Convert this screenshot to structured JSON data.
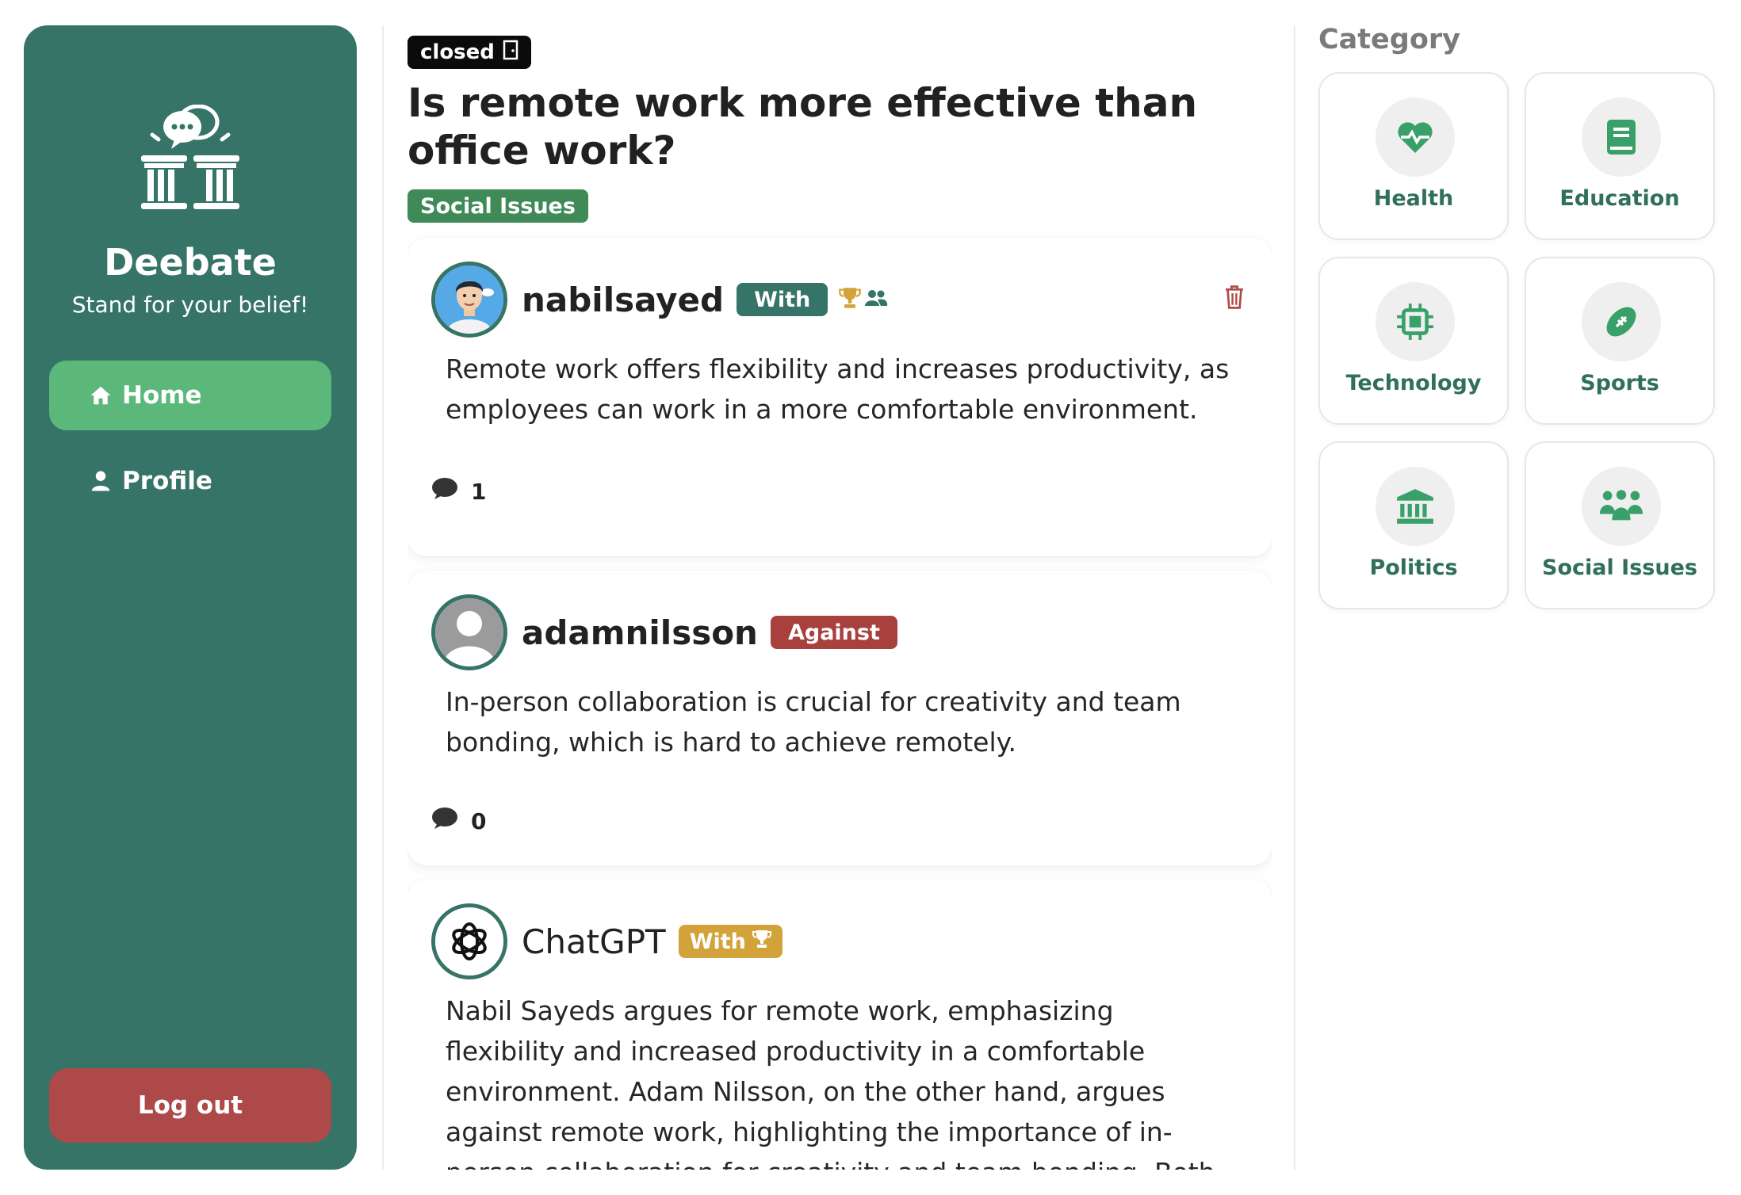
{
  "sidebar": {
    "brand": "Deebate",
    "tagline": "Stand for your belief!",
    "nav": [
      {
        "label": "Home",
        "icon": "home-icon",
        "active": true
      },
      {
        "label": "Profile",
        "icon": "user-icon",
        "active": false
      }
    ],
    "logout_label": "Log out"
  },
  "debate": {
    "status": "closed",
    "title": "Is remote work more effective than office work?",
    "category": "Social Issues"
  },
  "arguments": [
    {
      "username": "nabilsayed",
      "stance": "With",
      "text": "Remote work offers flexibility and increases productivity, as employees can work in a more comfortable environment.",
      "comment_count": "1"
    },
    {
      "username": "adamnilsson",
      "stance": "Against",
      "text": "In-person collaboration is crucial for creativity and team bonding, which is hard to achieve remotely.",
      "comment_count": "0"
    },
    {
      "username": "ChatGPT",
      "stance": "With",
      "text": "Nabil Sayeds argues for remote work, emphasizing flexibility and increased productivity in a comfortable environment. Adam Nilsson, on the other hand, argues against remote work, highlighting the importance of in-person collaboration for creativity and team bonding. Both participants present"
    }
  ],
  "categories": {
    "title": "Category",
    "items": [
      {
        "label": "Health",
        "icon": "heart-pulse-icon"
      },
      {
        "label": "Education",
        "icon": "book-icon"
      },
      {
        "label": "Technology",
        "icon": "chip-icon"
      },
      {
        "label": "Sports",
        "icon": "football-icon"
      },
      {
        "label": "Politics",
        "icon": "government-building-icon"
      },
      {
        "label": "Social Issues",
        "icon": "people-group-icon"
      }
    ]
  },
  "colors": {
    "sidebar": "#357466",
    "active_nav": "#5cb77a",
    "logout": "#ad4a49",
    "with": "#357466",
    "against": "#a8403e",
    "ai_badge": "#d3a33b",
    "category_tag": "#3f8a57",
    "category_icon": "#3aa06a"
  }
}
